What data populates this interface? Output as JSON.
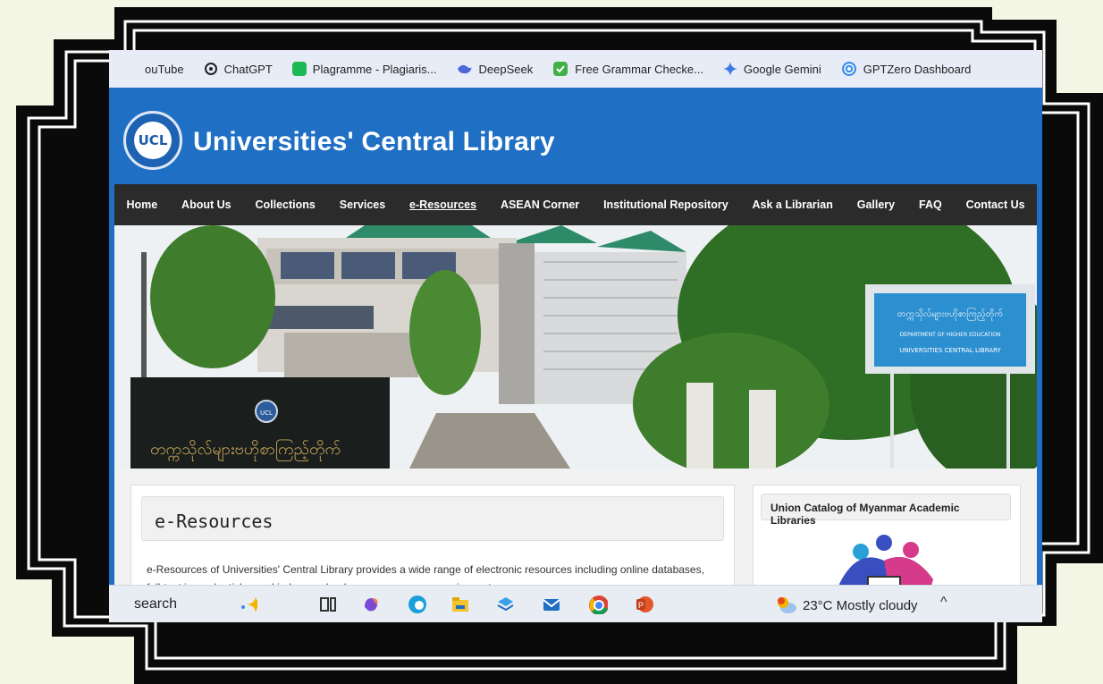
{
  "bookmarks": [
    {
      "label": "ouTube",
      "icon": "youtube-icon",
      "color": "#e02020"
    },
    {
      "label": "ChatGPT",
      "icon": "chatgpt-icon",
      "color": "#222222"
    },
    {
      "label": "Plagramme - Plagiaris...",
      "icon": "plagramme-icon",
      "color": "#1db954"
    },
    {
      "label": "DeepSeek",
      "icon": "deepseek-icon",
      "color": "#4b67d8"
    },
    {
      "label": "Free Grammar Checke...",
      "icon": "grammar-check-icon",
      "color": "#43b047"
    },
    {
      "label": "Google Gemini",
      "icon": "gemini-icon",
      "color": "#3d7ce8"
    },
    {
      "label": "GPTZero Dashboard",
      "icon": "gptzero-icon",
      "color": "#3a8ee6"
    }
  ],
  "site": {
    "logo_text": "UCL",
    "title": "Universities' Central Library"
  },
  "nav": [
    {
      "label": "Home"
    },
    {
      "label": "About Us"
    },
    {
      "label": "Collections"
    },
    {
      "label": "Services"
    },
    {
      "label": "e-Resources"
    },
    {
      "label": "ASEAN Corner"
    },
    {
      "label": "Institutional Repository"
    },
    {
      "label": "Ask a Librarian"
    },
    {
      "label": "Gallery"
    },
    {
      "label": "FAQ"
    },
    {
      "label": "Contact Us"
    }
  ],
  "hero": {
    "sign_myanmar": "တက္ကသိုလ်များဗဟိုစာကြည့်တိုက်",
    "sign_dept": "DEPARTMENT OF HIGHER EDUCATION",
    "sign_english": "UNIVERSITIES CENTRAL LIBRARY",
    "wall_text": "တက္ကသိုလ်များဗဟိုစာကြည့်တိုက်",
    "wall_logo": "UCL"
  },
  "main": {
    "title": "e-Resources",
    "text": "e-Resources of Universities' Central Library provides a wide range of electronic resources including online databases, full-text journal articles and indexes, ebooks, newspapers, magazines, etc."
  },
  "sidebar": {
    "title": "Union Catalog of Myanmar Academic Libraries"
  },
  "taskbar": {
    "search_text": "search",
    "weather": "23°C  Mostly cloudy",
    "chevron": "^"
  },
  "colors": {
    "site_blue": "#1f6fc5",
    "nav_bg": "#2b2b2b"
  }
}
